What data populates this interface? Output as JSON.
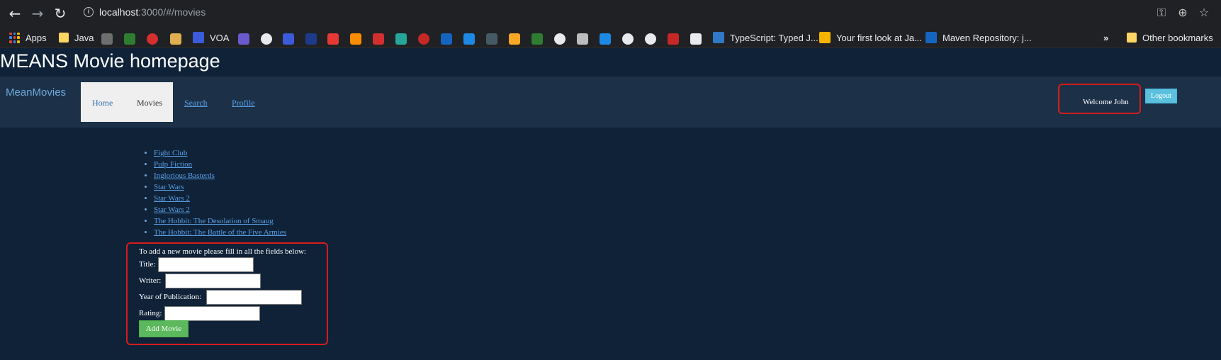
{
  "browser": {
    "url_host": "localhost",
    "url_rest": ":3000/#/movies",
    "bookmarks": {
      "apps": "Apps",
      "java": "Java",
      "voa": "VOA",
      "typescript": "TypeScript: Typed J...",
      "first_look": "Your first look at Ja...",
      "maven": "Maven Repository: j...",
      "other": "Other bookmarks",
      "overflow": "»"
    }
  },
  "page": {
    "title": "MEANS Movie homepage"
  },
  "navbar": {
    "brand": "MeanMovies",
    "home": "Home",
    "movies": "Movies",
    "search": "Search",
    "profile": "Profile",
    "welcome": "Welcome John",
    "logout": "Logout"
  },
  "movies": [
    "Fight Club",
    "Pulp Fiction",
    "Inglorious Basterds",
    "Star Wars",
    "Star Wars 2",
    "Star Wars 2",
    "The Hobbit: The Desolation of Smaug",
    "The Hobbit: The Battle of the Five Armies"
  ],
  "form": {
    "intro": "To add a new movie please fill in all the fields below:",
    "title_label": "Title:",
    "writer_label": "Writer:",
    "year_label": "Year of Publication:",
    "rating_label": "Rating:",
    "submit": "Add Movie"
  }
}
